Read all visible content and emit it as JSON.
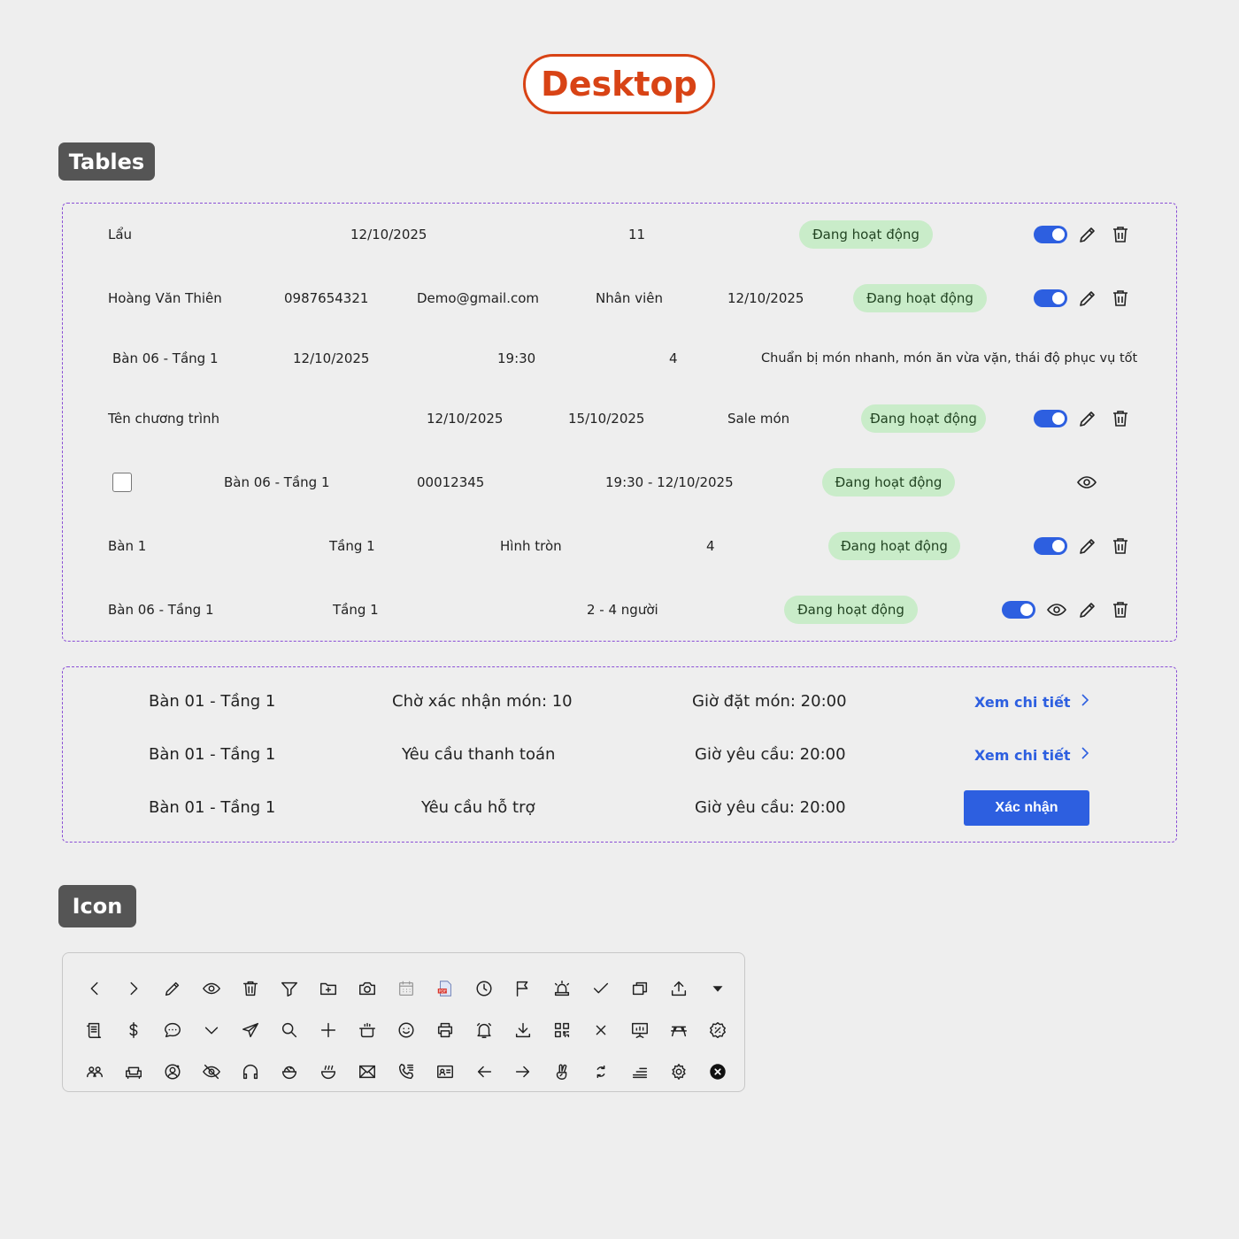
{
  "header": {
    "title": "Desktop"
  },
  "sections": {
    "tables_label": "Tables",
    "icon_label": "Icon"
  },
  "rows": {
    "r1": {
      "c1": "Lẩu",
      "c2": "12/10/2025",
      "c3": "11",
      "status": "Đang hoạt động"
    },
    "r2": {
      "c1": "Hoàng Văn Thiên",
      "c2": "0987654321",
      "c3": "Demo@gmail.com",
      "c4": "Nhân viên",
      "c5": "12/10/2025",
      "status": "Đang hoạt động"
    },
    "r3": {
      "c1": "Bàn 06 - Tầng 1",
      "c2": "12/10/2025",
      "c3": "19:30",
      "c4": "4",
      "c5": "Chuẩn bị món nhanh, món ăn vừa vặn, thái độ phục vụ tốt"
    },
    "r4": {
      "c1": "Tên chương trình",
      "c2": "12/10/2025",
      "c3": "15/10/2025",
      "c4": "Sale món",
      "status": "Đang hoạt động"
    },
    "r5": {
      "c1": "Bàn 06 - Tầng 1",
      "c2": "00012345",
      "c3": "19:30 - 12/10/2025",
      "status": "Đang hoạt động"
    },
    "r6": {
      "c1": "Bàn 1",
      "c2": "Tầng 1",
      "c3": "Hình tròn",
      "c4": "4",
      "status": "Đang hoạt động"
    },
    "r7": {
      "c1": "Bàn 06 - Tầng 1",
      "c2": "Tầng 1",
      "c3": "2 - 4 người",
      "status": "Đang hoạt động"
    }
  },
  "requests": [
    {
      "table": "Bàn 01 - Tầng 1",
      "type": "Chờ xác nhận món: 10",
      "time": "Giờ đặt món: 20:00",
      "action": "Xem chi tiết"
    },
    {
      "table": "Bàn 01 - Tầng 1",
      "type": "Yêu cầu thanh toán",
      "time": "Giờ yêu cầu: 20:00",
      "action": "Xem chi tiết"
    },
    {
      "table": "Bàn 01 - Tầng 1",
      "type": "Yêu cầu hỗ trợ",
      "time": "Giờ yêu cầu: 20:00",
      "action": "Xác nhận"
    }
  ],
  "colors": {
    "accent": "#2d5fe0",
    "brand": "#d84315",
    "badge_bg": "#c9ecc9",
    "dashed": "#8a4fd6"
  },
  "icons": [
    "chevron-left-icon",
    "chevron-right-icon",
    "pencil-icon",
    "eye-icon",
    "trash-icon",
    "filter-icon",
    "folder-add-icon",
    "camera-icon",
    "calendar-icon",
    "pdf-icon",
    "clock-icon",
    "flag-icon",
    "alarm-light-icon",
    "check-icon",
    "windows-icon",
    "upload-icon",
    "caret-down-icon",
    "receipt-icon",
    "dollar-icon",
    "chat-icon",
    "chevron-down-icon",
    "send-icon",
    "search-icon",
    "plus-icon",
    "pot-icon",
    "smile-icon",
    "printer-icon",
    "bell-icon",
    "download-icon",
    "qr-code-icon",
    "close-icon",
    "presentation-icon",
    "picnic-table-icon",
    "discount-badge-icon",
    "users-icon",
    "sofa-icon",
    "user-circle-icon",
    "eye-off-icon",
    "headphones-icon",
    "rice-bowl-icon",
    "noodle-bowl-icon",
    "mail-icon",
    "phone-call-icon",
    "id-card-icon",
    "arrow-left-icon",
    "arrow-right-icon",
    "peace-hand-icon",
    "refresh-icon",
    "menu-lines-icon",
    "gear-icon",
    "x-circle-icon"
  ]
}
